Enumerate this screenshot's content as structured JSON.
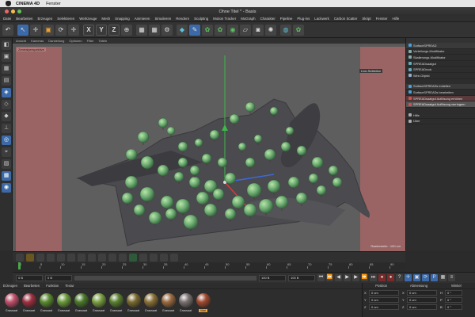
{
  "mac_menu": {
    "app_name": "CINEMA 4D",
    "items": [
      "Fenster"
    ]
  },
  "window": {
    "title": "Ohne Titel * - Basis"
  },
  "app_menu": [
    "Datei",
    "Bearbeiten",
    "Erzeugen",
    "Selektieren",
    "Werkzeuge",
    "Mesh",
    "Snapping",
    "Animieren",
    "Simulieren",
    "Rendern",
    "Sculpting",
    "Motion Tracker",
    "MoGraph",
    "Charakter",
    "Pipeline",
    "Plug-ins",
    "Lackwerk",
    "Carbon Scatter",
    "Skript",
    "Fenster",
    "Hilfe"
  ],
  "toolbar": {
    "axis_x": "X",
    "axis_y": "Y",
    "axis_z": "Z"
  },
  "viewport": {
    "menu": [
      "Ansicht",
      "Kameras",
      "Darstellung",
      "Optionen",
      "Filter",
      "Tafeln"
    ],
    "label": "Zentralperspektive",
    "footer": "Rasterweite : 100 cm",
    "live_selection": "Live-Selektion"
  },
  "object_panel": {
    "items": [
      {
        "label": "SurfaceSPREAD",
        "icon_color": "#4aa0d8",
        "style": "dark"
      },
      {
        "label": "Verteilungs-Modifikator",
        "icon_color": "#8aa",
        "style": ""
      },
      {
        "label": "Skalierungs-Modifikator",
        "icon_color": "#8aa",
        "style": ""
      },
      {
        "label": "SPREADsaatgut",
        "icon_color": "#6ab",
        "style": ""
      },
      {
        "label": "SPREADrock",
        "icon_color": "#6ab",
        "style": ""
      },
      {
        "label": "Wire-Objekt",
        "icon_color": "#9ac",
        "style": ""
      },
      {
        "label": "SurfaceSPREADs erstellen",
        "icon_color": "#4aa0d8",
        "style": "dark"
      },
      {
        "label": "SurfaceSPREADs bearbeiten",
        "icon_color": "#4aa0d8",
        "style": ""
      },
      {
        "label": "SPREADsaatgut Auflösung erhöhen",
        "icon_color": "#d05050",
        "style": "red"
      },
      {
        "label": "SPREADsaatgut Auflösung verringern",
        "icon_color": "#d05050",
        "style": "hl"
      },
      {
        "label": "Hilfe",
        "icon_color": "#aaa",
        "style": ""
      },
      {
        "label": "Über",
        "icon_color": "#aaa",
        "style": ""
      }
    ]
  },
  "timeline": {
    "ticks": [
      "0",
      "5",
      "10",
      "15",
      "20",
      "25",
      "30",
      "35",
      "40",
      "45",
      "50",
      "55",
      "60",
      "65",
      "70",
      "75",
      "80",
      "85",
      "90"
    ]
  },
  "transport": {
    "start": "0 B",
    "current": "0 B",
    "end": "100 B",
    "end2": "100 B"
  },
  "materials": {
    "menu": [
      "Erzeugen",
      "Bearbeiten",
      "Funktion",
      "Textur"
    ],
    "items": [
      {
        "label": "Grassaat",
        "color": "#c0506a"
      },
      {
        "label": "Grassaat",
        "color": "#a03040"
      },
      {
        "label": "Grassaat",
        "color": "#5a8a30"
      },
      {
        "label": "Grassaat",
        "color": "#6a9a3a"
      },
      {
        "label": "Grassaat",
        "color": "#4a7a2a"
      },
      {
        "label": "Grassaat",
        "color": "#7aa040"
      },
      {
        "label": "Grassaat",
        "color": "#5a8030"
      },
      {
        "label": "Grassaat",
        "color": "#7a6a30"
      },
      {
        "label": "Grassaat",
        "color": "#8a7038"
      },
      {
        "label": "Grassaat",
        "color": "#9a6a40"
      },
      {
        "label": "Grassaat",
        "color": "#7a7070"
      },
      {
        "label": "Mat",
        "color": "#a04a30",
        "selected": true
      }
    ]
  },
  "coordinates": {
    "headers": [
      "Position",
      "Abmessung",
      "Winkel"
    ],
    "rows": [
      {
        "axis": "X",
        "pos": "0 cm",
        "size": "0 cm",
        "angle_axis": "H",
        "angle": "0 °"
      },
      {
        "axis": "Y",
        "pos": "0 cm",
        "size": "0 cm",
        "angle_axis": "P",
        "angle": "0 °"
      },
      {
        "axis": "Z",
        "pos": "0 cm",
        "size": "0 cm",
        "angle_axis": "B",
        "angle": "0 °"
      }
    ]
  }
}
